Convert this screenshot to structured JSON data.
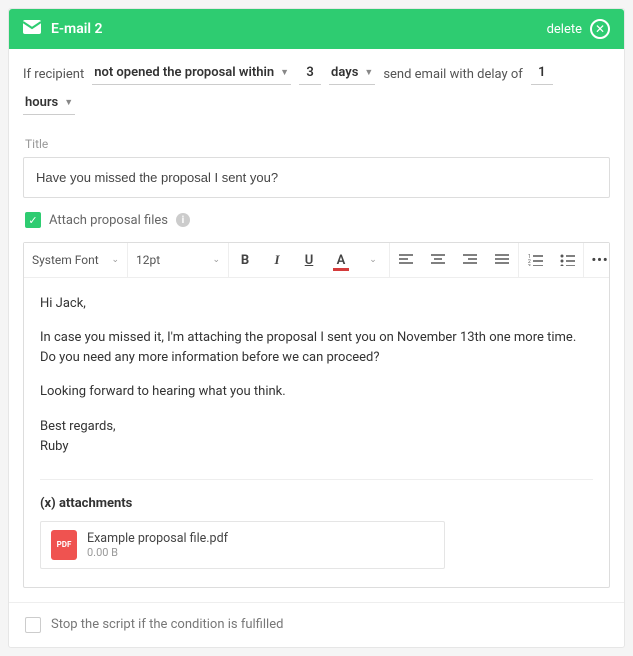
{
  "header": {
    "title": "E-mail 2",
    "delete_label": "delete"
  },
  "condition": {
    "prefix": "If recipient",
    "action": "not opened the proposal within",
    "count": "3",
    "unit": "days",
    "mid": "send email with delay of",
    "delay": "1",
    "delay_unit": "hours"
  },
  "title": {
    "label": "Title",
    "value": "Have you missed the proposal I sent you?"
  },
  "attach_checkbox": {
    "checked": true,
    "label": "Attach proposal files"
  },
  "toolbar": {
    "font": "System Font",
    "size": "12pt"
  },
  "body": {
    "p1": "Hi Jack,",
    "p2": "In case you missed it, I'm attaching the proposal I sent you on November 13th one more time. Do you need any more information before we can proceed?",
    "p3": "Looking forward to hearing what you think.",
    "p4": "Best regards,",
    "p5": "Ruby"
  },
  "attachments": {
    "heading": "(x) attachments",
    "file_badge": "PDF",
    "file_name": "Example proposal file.pdf",
    "file_size": "0.00 B"
  },
  "footer": {
    "stop_label": "Stop the script if the condition is fulfilled"
  }
}
